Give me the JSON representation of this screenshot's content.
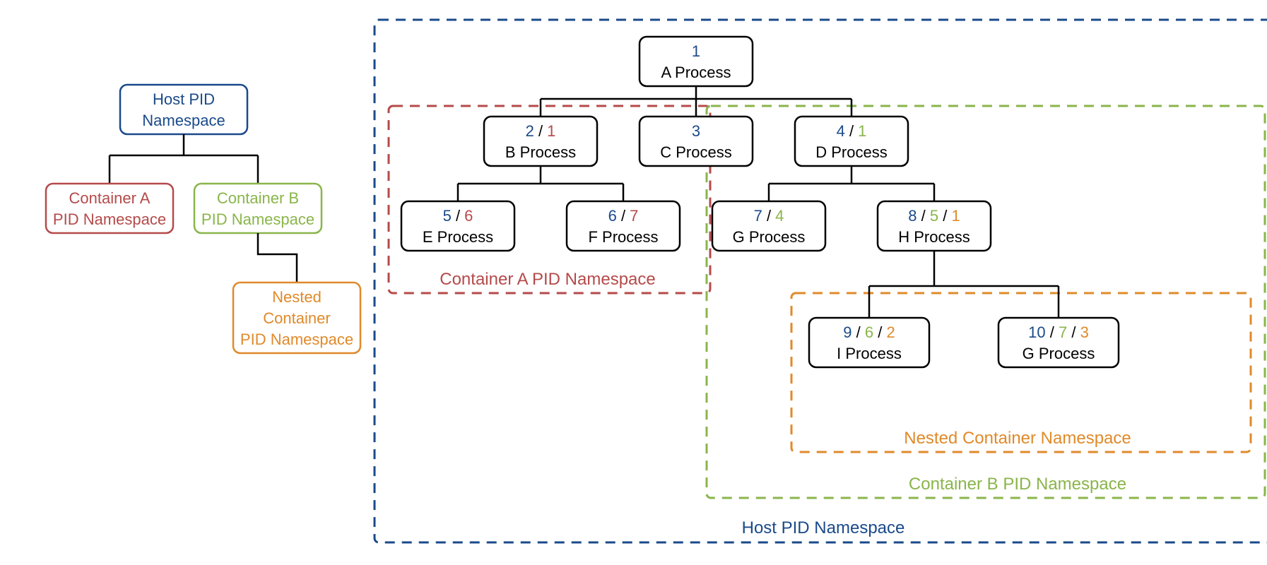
{
  "colors": {
    "host": "#1a4a8a",
    "containerA": "#b54a4a",
    "containerB": "#8ab54a",
    "nested": "#e08a2a"
  },
  "left_tree": {
    "host": {
      "l1": "Host PID",
      "l2": "Namespace"
    },
    "ca": {
      "l1": "Container A",
      "l2": "PID Namespace"
    },
    "cb": {
      "l1": "Container B",
      "l2": "PID Namespace"
    },
    "nested": {
      "l1": "Nested",
      "l2": "Container",
      "l3": "PID Namespace"
    }
  },
  "right": {
    "host_label": "Host PID Namespace",
    "ca_label": "Container A PID Namespace",
    "cb_label": "Container B PID Namespace",
    "nc_label": "Nested Container Namespace"
  },
  "proc": {
    "A": {
      "name": "A Process",
      "pids": [
        {
          "v": "1",
          "ns": "host"
        }
      ]
    },
    "B": {
      "name": "B Process",
      "pids": [
        {
          "v": "2",
          "ns": "host"
        },
        {
          "v": "1",
          "ns": "ca"
        }
      ]
    },
    "C": {
      "name": "C Process",
      "pids": [
        {
          "v": "3",
          "ns": "host"
        }
      ]
    },
    "D": {
      "name": "D Process",
      "pids": [
        {
          "v": "4",
          "ns": "host"
        },
        {
          "v": "1",
          "ns": "cb"
        }
      ]
    },
    "E": {
      "name": "E Process",
      "pids": [
        {
          "v": "5",
          "ns": "host"
        },
        {
          "v": "6",
          "ns": "ca"
        }
      ]
    },
    "F": {
      "name": "F Process",
      "pids": [
        {
          "v": "6",
          "ns": "host"
        },
        {
          "v": "7",
          "ns": "ca"
        }
      ]
    },
    "G": {
      "name": "G Process",
      "pids": [
        {
          "v": "7",
          "ns": "host"
        },
        {
          "v": "4",
          "ns": "cb"
        }
      ]
    },
    "H": {
      "name": "H Process",
      "pids": [
        {
          "v": "8",
          "ns": "host"
        },
        {
          "v": "5",
          "ns": "cb"
        },
        {
          "v": "1",
          "ns": "nc"
        }
      ]
    },
    "I": {
      "name": "I Process",
      "pids": [
        {
          "v": "9",
          "ns": "host"
        },
        {
          "v": "6",
          "ns": "cb"
        },
        {
          "v": "2",
          "ns": "nc"
        }
      ]
    },
    "J": {
      "name": "G Process",
      "pids": [
        {
          "v": "10",
          "ns": "host"
        },
        {
          "v": "7",
          "ns": "cb"
        },
        {
          "v": "3",
          "ns": "nc"
        }
      ]
    }
  }
}
